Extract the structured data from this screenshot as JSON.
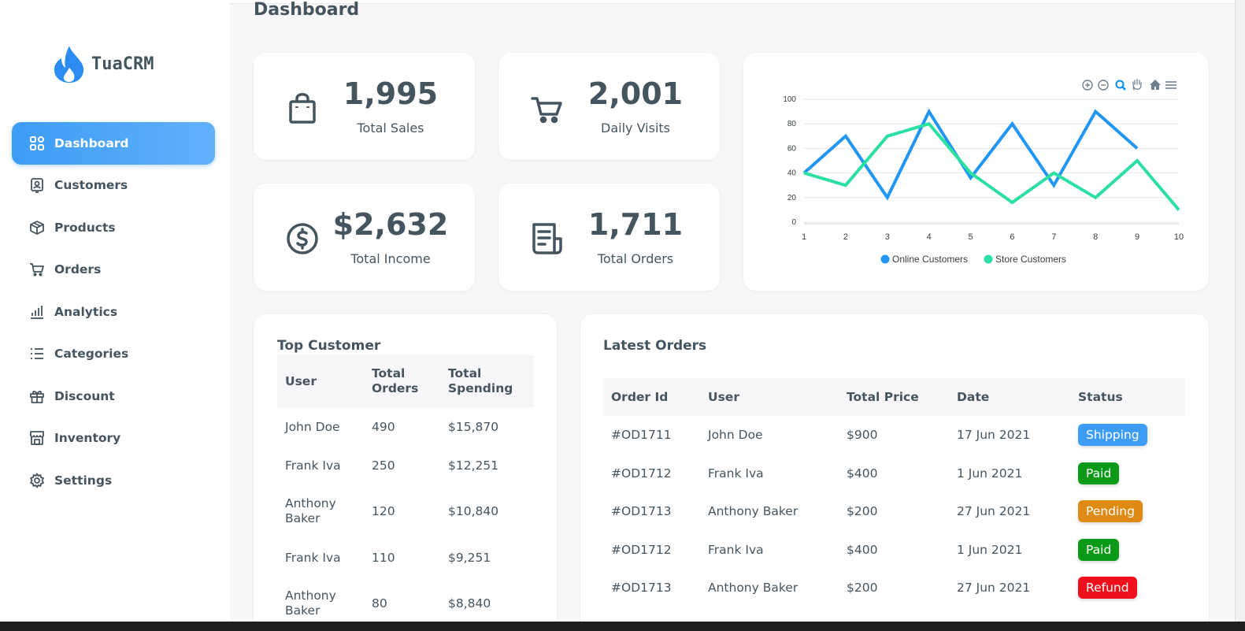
{
  "app": {
    "logo_text": "TuaCRM"
  },
  "sidebar": {
    "items": [
      {
        "label": "Dashboard",
        "icon": "dashboard-icon",
        "active": true
      },
      {
        "label": "Customers",
        "icon": "customers-icon"
      },
      {
        "label": "Products",
        "icon": "box-icon"
      },
      {
        "label": "Orders",
        "icon": "cart-icon"
      },
      {
        "label": "Analytics",
        "icon": "bar-chart-icon"
      },
      {
        "label": "Categories",
        "icon": "list-icon"
      },
      {
        "label": "Discount",
        "icon": "gift-icon"
      },
      {
        "label": "Inventory",
        "icon": "store-icon"
      },
      {
        "label": "Settings",
        "icon": "gear-icon"
      }
    ]
  },
  "page": {
    "title": "Dashboard"
  },
  "stats": [
    {
      "value": "1,995",
      "label": "Total Sales",
      "icon": "bag-icon"
    },
    {
      "value": "2,001",
      "label": "Daily Visits",
      "icon": "cart-icon"
    },
    {
      "value": "$2,632",
      "label": "Total Income",
      "icon": "dollar-icon"
    },
    {
      "value": "1,711",
      "label": "Total Orders",
      "icon": "receipt-icon"
    }
  ],
  "chart_data": {
    "type": "line",
    "x": [
      1,
      2,
      3,
      4,
      5,
      6,
      7,
      8,
      9,
      10
    ],
    "series": [
      {
        "name": "Online Customers",
        "color": "#2196f3",
        "values": [
          40,
          70,
          20,
          90,
          36,
          80,
          30,
          90,
          60,
          null
        ]
      },
      {
        "name": "Store Customers",
        "color": "#2be0a0",
        "values": [
          40,
          30,
          70,
          80,
          40,
          16,
          40,
          20,
          50,
          10
        ]
      }
    ],
    "ylim": [
      0,
      100
    ],
    "yticks": [
      0,
      20,
      40,
      60,
      80,
      100
    ],
    "xticks": [
      1,
      2,
      3,
      4,
      5,
      6,
      7,
      8,
      9,
      10
    ],
    "grid": true,
    "legend_position": "bottom",
    "toolbar_icons": [
      "zoom-in-icon",
      "zoom-out-icon",
      "zoom-select-icon",
      "pan-icon",
      "home-icon",
      "menu-icon"
    ]
  },
  "top_customers": {
    "title": "Top Customer",
    "headers": [
      "User",
      "Total Orders",
      "Total Spending"
    ],
    "rows": [
      [
        "John Doe",
        "490",
        "$15,870"
      ],
      [
        "Frank Iva",
        "250",
        "$12,251"
      ],
      [
        "Anthony Baker",
        "120",
        "$10,840"
      ],
      [
        "Frank Iva",
        "110",
        "$9,251"
      ],
      [
        "Anthony Baker",
        "80",
        "$8,840"
      ]
    ]
  },
  "latest_orders": {
    "title": "Latest Orders",
    "headers": [
      "Order Id",
      "User",
      "Total Price",
      "Date",
      "Status"
    ],
    "rows": [
      {
        "id": "#OD1711",
        "user": "John Doe",
        "price": "$900",
        "date": "17 Jun 2021",
        "status": "Shipping",
        "status_color": "#3d9cf5"
      },
      {
        "id": "#OD1712",
        "user": "Frank Iva",
        "price": "$400",
        "date": "1 Jun 2021",
        "status": "Paid",
        "status_color": "#0b9a17"
      },
      {
        "id": "#OD1713",
        "user": "Anthony Baker",
        "price": "$200",
        "date": "27 Jun 2021",
        "status": "Pending",
        "status_color": "#de8a14"
      },
      {
        "id": "#OD1712",
        "user": "Frank Iva",
        "price": "$400",
        "date": "1 Jun 2021",
        "status": "Paid",
        "status_color": "#0b9a17"
      },
      {
        "id": "#OD1713",
        "user": "Anthony Baker",
        "price": "$200",
        "date": "27 Jun 2021",
        "status": "Refund",
        "status_color": "#f0101b"
      }
    ]
  },
  "colors": {
    "accent": "#3d9cf5",
    "text": "#455560",
    "background": "#f7f7f9"
  }
}
